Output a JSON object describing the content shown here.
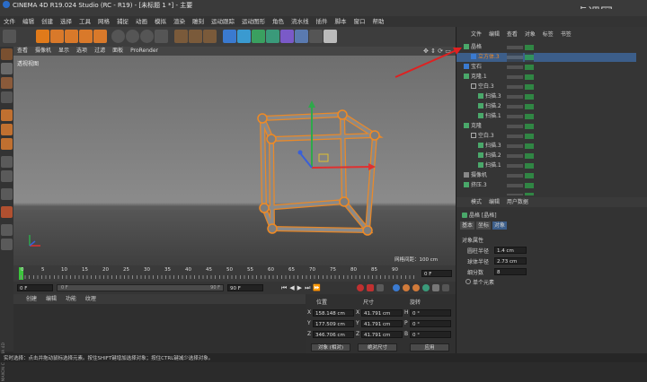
{
  "window": {
    "title": "CINEMA 4D R19.024 Studio (RC - R19) - [未标题 1 *] - 主要"
  },
  "watermark": "虎课网",
  "menu": [
    "文件",
    "编辑",
    "创建",
    "选择",
    "工具",
    "网格",
    "捕捉",
    "动画",
    "模拟",
    "渲染",
    "雕刻",
    "运动跟踪",
    "运动图形",
    "角色",
    "流水线",
    "插件",
    "脚本",
    "窗口",
    "帮助"
  ],
  "viewport": {
    "menu": [
      "查看",
      "摄像机",
      "显示",
      "选项",
      "过滤",
      "面板",
      "ProRender"
    ],
    "label": "透视视图",
    "grid_distance": "网格间距：100 cm"
  },
  "timeline": {
    "ticks": [
      "0",
      "5",
      "10",
      "15",
      "20",
      "25",
      "30",
      "35",
      "40",
      "45",
      "50",
      "55",
      "60",
      "65",
      "70",
      "75",
      "80",
      "85",
      "90"
    ],
    "end_frame": "0 F"
  },
  "controls": {
    "start": "0 F",
    "range_start": "0 F",
    "range_end": "90 F",
    "end": "90 F",
    "current": "90 F"
  },
  "material_menu": [
    "创建",
    "编辑",
    "功能",
    "纹理"
  ],
  "coordinates": {
    "headers": [
      "位置",
      "尺寸",
      "旋转"
    ],
    "rows": [
      {
        "axis": "X",
        "pos": "158.148 cm",
        "size_axis": "X",
        "size": "41.791 cm",
        "rot_axis": "H",
        "rot": "0 °"
      },
      {
        "axis": "Y",
        "pos": "177.509 cm",
        "size_axis": "Y",
        "size": "41.791 cm",
        "rot_axis": "P",
        "rot": "0 °"
      },
      {
        "axis": "Z",
        "pos": "346.706 cm",
        "size_axis": "Z",
        "size": "41.791 cm",
        "rot_axis": "B",
        "rot": "0 °"
      }
    ],
    "mode": "对象 (相对)",
    "size_mode": "绝对尺寸",
    "apply": "应用"
  },
  "object_manager": {
    "tabs": [
      "文件",
      "编辑",
      "查看",
      "对象",
      "标签",
      "书签"
    ],
    "items": [
      {
        "name": "晶格",
        "indent": 0
      },
      {
        "name": "立方体.3",
        "indent": 1
      },
      {
        "name": "宝石",
        "indent": 0
      },
      {
        "name": "克隆.1",
        "indent": 0
      },
      {
        "name": "空白.3",
        "indent": 1
      },
      {
        "name": "扫描.3",
        "indent": 2
      },
      {
        "name": "扫描.2",
        "indent": 2
      },
      {
        "name": "扫描.1",
        "indent": 2
      },
      {
        "name": "克隆",
        "indent": 0
      },
      {
        "name": "空白.3",
        "indent": 1
      },
      {
        "name": "扫描.3",
        "indent": 2
      },
      {
        "name": "扫描.2",
        "indent": 2
      },
      {
        "name": "扫描.1",
        "indent": 2
      },
      {
        "name": "摄像机",
        "indent": 0
      },
      {
        "name": "挤压.3",
        "indent": 0
      }
    ]
  },
  "attributes": {
    "tabs": [
      "模式",
      "编辑",
      "用户数据"
    ],
    "object_title": "晶格 [晶格]",
    "subtabs": [
      "基本",
      "坐标",
      "对象"
    ],
    "section": "对象属性",
    "fields": [
      {
        "label": "圆柱半径",
        "value": "1.4 cm"
      },
      {
        "label": "球体半径",
        "value": "2.73 cm"
      },
      {
        "label": "细分数",
        "value": "8"
      }
    ],
    "checkbox": "单个元素"
  },
  "status": "实时选择：点击并拖动鼠标选择元素。按住SHIFT键增加选择对象；按住CTRL键减少选择对象。",
  "side_brand": "MAXON CINEMA 4D",
  "colors": {
    "accent": "#f08a24",
    "select_blue": "#3c5e8a",
    "axis_red": "#e03030",
    "axis_green": "#2ea84a",
    "axis_blue": "#3a60d8",
    "timeline_green": "#3cc43c"
  }
}
